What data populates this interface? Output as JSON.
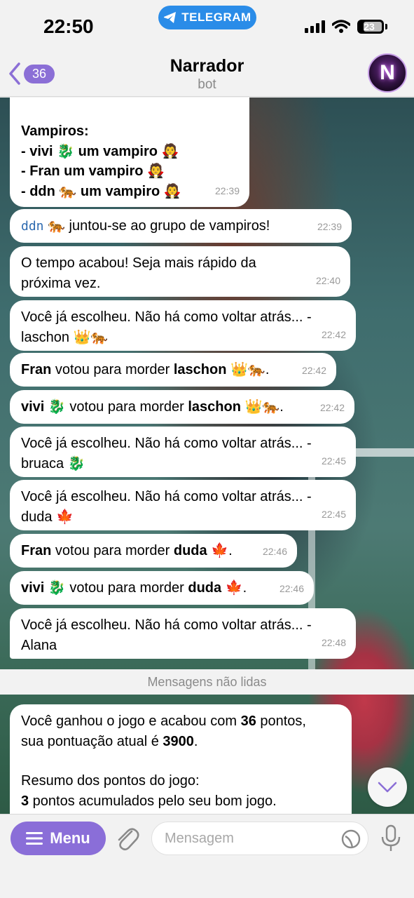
{
  "status": {
    "time": "22:50",
    "pill_label": "TELEGRAM",
    "battery": "23"
  },
  "header": {
    "back_count": "36",
    "title": "Narrador",
    "subtitle": "bot",
    "avatar_letter": "N"
  },
  "messages": [
    {
      "lines": [
        "Vampiros:",
        "- vivi 🐉 um vampiro 🧛",
        "- Fran um vampiro 🧛",
        "- ddn 🐅 um vampiro 🧛"
      ],
      "time": "22:39"
    },
    {
      "pre_mono": "ddn",
      "text": " 🐅 juntou-se ao grupo de vampiros!",
      "time": "22:39"
    },
    {
      "text": "O tempo acabou! Seja mais rápido da próxima vez.",
      "time": "22:40"
    },
    {
      "text": "Você já escolheu. Não há como voltar atrás... - laschon 👑🐅",
      "time": "22:42"
    },
    {
      "bold1": "Fran",
      "mid": " votou para morder ",
      "bold2": "laschon",
      "tail": " 👑🐅.",
      "time": "22:42"
    },
    {
      "bold1": "vivi",
      "mid": " 🐉 votou para morder ",
      "bold2": "laschon",
      "tail": " 👑🐅.",
      "time": "22:42"
    },
    {
      "text": "Você já escolheu. Não há como voltar atrás... - bruaca 🐉",
      "time": "22:45"
    },
    {
      "text": "Você já escolheu. Não há como voltar atrás... - duda 🍁",
      "time": "22:45"
    },
    {
      "bold1": "Fran",
      "mid": " votou para morder ",
      "bold2": "duda",
      "tail": " 🍁.",
      "time": "22:46"
    },
    {
      "bold1": "vivi",
      "mid": " 🐉 votou para morder ",
      "bold2": "duda",
      "tail": " 🍁.",
      "time": "22:46"
    },
    {
      "text": "Você já escolheu. Não há como voltar atrás... - Alana",
      "time": "22:48"
    }
  ],
  "unread_label": "Mensagens não lidas",
  "final_message": {
    "p1a": "Você ganhou o jogo e acabou com ",
    "p1b": "36",
    "p1c": " pontos,",
    "p2a": "sua pontuação atual é ",
    "p2b": "3900",
    "p2c": ".",
    "p3": "Resumo dos pontos do jogo:",
    "p4a": "3",
    "p4b": " pontos acumulados pelo seu bom jogo."
  },
  "composer": {
    "menu_label": "Menu",
    "placeholder": "Mensagem"
  }
}
